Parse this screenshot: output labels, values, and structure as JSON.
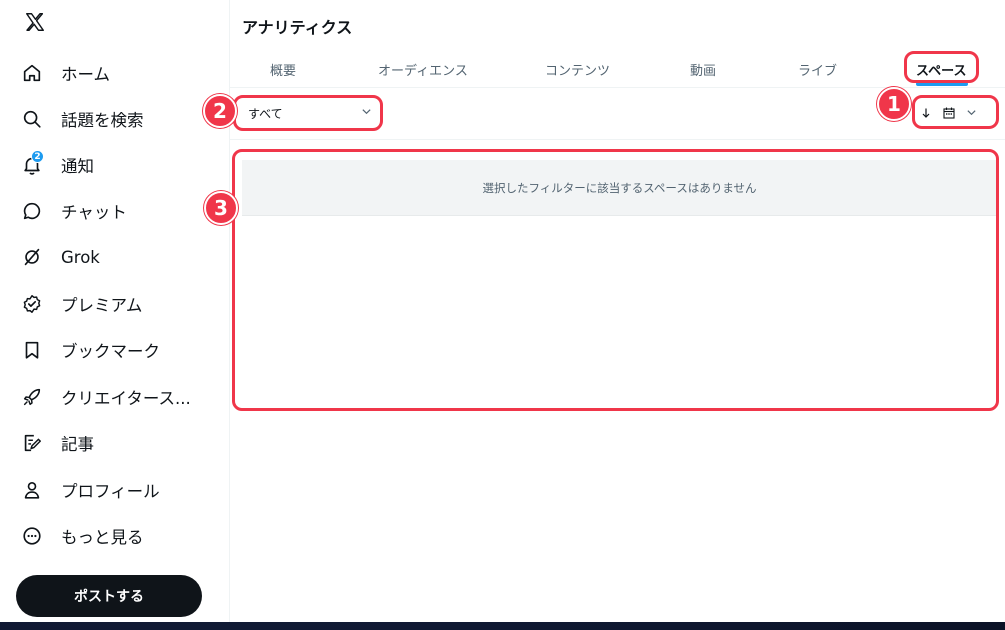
{
  "app": {
    "logo_icon": "x-logo-icon"
  },
  "sidebar": {
    "items": [
      {
        "label": "ホーム",
        "icon": "home-icon"
      },
      {
        "label": "話題を検索",
        "icon": "search-icon"
      },
      {
        "label": "通知",
        "icon": "bell-icon",
        "badge": "2"
      },
      {
        "label": "チャット",
        "icon": "chat-bubble-icon"
      },
      {
        "label": "Grok",
        "icon": "grok-icon"
      },
      {
        "label": "プレミアム",
        "icon": "premium-badge-icon"
      },
      {
        "label": "ブックマーク",
        "icon": "bookmark-icon"
      },
      {
        "label": "クリエイタース...",
        "icon": "rocket-icon"
      },
      {
        "label": "記事",
        "icon": "article-icon"
      },
      {
        "label": "プロフィール",
        "icon": "person-icon"
      },
      {
        "label": "もっと見る",
        "icon": "more-circle-icon"
      }
    ],
    "post_button": "ポストする"
  },
  "main": {
    "title": "アナリティクス",
    "tabs": [
      {
        "label": "概要"
      },
      {
        "label": "オーディエンス"
      },
      {
        "label": "コンテンツ"
      },
      {
        "label": "動画"
      },
      {
        "label": "ライブ"
      },
      {
        "label": "スペース",
        "active": true
      }
    ],
    "filter": {
      "selected": "すべて"
    },
    "sort": {
      "direction_icon": "arrow-down-icon",
      "date_icon": "calendar-icon"
    },
    "empty_message": "選択したフィルターに該当するスペースはありません"
  },
  "annotations": {
    "labels": [
      "1",
      "2",
      "3"
    ],
    "color": "#f0364a"
  },
  "colors": {
    "accent": "#1d9bf0",
    "text": "#0f1419",
    "muted": "#536471"
  }
}
